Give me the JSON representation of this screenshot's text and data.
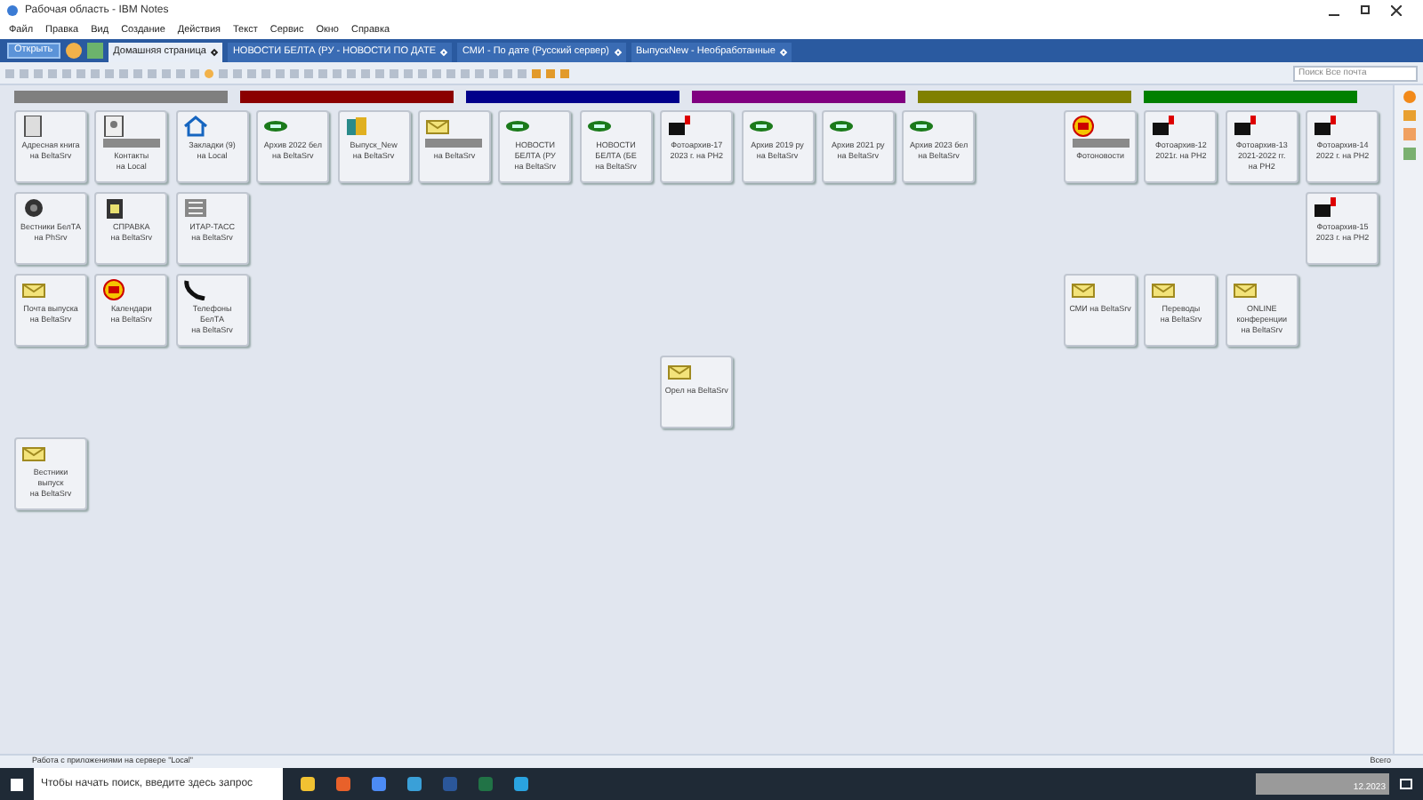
{
  "window": {
    "title": "Рабочая область - IBM Notes"
  },
  "menu": [
    "Файл",
    "Правка",
    "Вид",
    "Создание",
    "Действия",
    "Текст",
    "Сервис",
    "Окно",
    "Справка"
  ],
  "open_button": "Открыть",
  "tabs": [
    {
      "label": "Домашняя страница",
      "selected": true
    },
    {
      "label": "НОВОСТИ БЕЛТА (РУ - НОВОСТИ ПО ДАТЕ",
      "selected": false
    },
    {
      "label": "СМИ - По дате (Русский сервер)",
      "selected": false
    },
    {
      "label": "ВыпускNew - Необработанные",
      "selected": false
    }
  ],
  "search": {
    "placeholder": "Поиск Все почта"
  },
  "bands": [
    {
      "color": "#7f7f7f"
    },
    {
      "color": "#8b0000"
    },
    {
      "color": "#00008b"
    },
    {
      "color": "#800080"
    },
    {
      "color": "#808000"
    },
    {
      "color": "#008000"
    }
  ],
  "tiles": [
    {
      "kind": "book",
      "lines": [
        "Адресная книга",
        "на BeltaSrv"
      ],
      "redacted": false
    },
    {
      "kind": "contacts",
      "lines": [
        "Контакты",
        "на Local"
      ],
      "redacted": true
    },
    {
      "kind": "home",
      "lines": [
        "Закладки (9)",
        "на Local"
      ],
      "redacted": false
    },
    {
      "kind": "db",
      "lines": [
        "Архив 2022 бел",
        "на BeltaSrv"
      ],
      "redacted": false
    },
    {
      "kind": "books",
      "lines": [
        "Выпуск_New",
        "на BeltaSrv"
      ],
      "redacted": false
    },
    {
      "kind": "mail",
      "lines": [
        "на BeltaSrv"
      ],
      "redacted": true
    },
    {
      "kind": "db",
      "lines": [
        "НОВОСТИ",
        "БЕЛТА (РУ",
        "на BeltaSrv"
      ],
      "redacted": false
    },
    {
      "kind": "db",
      "lines": [
        "НОВОСТИ",
        "БЕЛТА (БЕ",
        "на BeltaSrv"
      ],
      "redacted": false
    },
    {
      "kind": "camera",
      "lines": [
        "Фотоархив-17",
        "2023 г. на PH2"
      ],
      "redacted": false
    },
    {
      "kind": "db",
      "lines": [
        "Архив 2019 ру",
        "на BeltaSrv"
      ],
      "redacted": false
    },
    {
      "kind": "db",
      "lines": [
        "Архив 2021 ру",
        "на BeltaSrv"
      ],
      "redacted": false
    },
    {
      "kind": "db",
      "lines": [
        "Архив 2023 бел",
        "на BeltaSrv"
      ],
      "redacted": false
    },
    {
      "kind": "stamp",
      "lines": [
        "Фотоновости"
      ],
      "redacted": true
    },
    {
      "kind": "camera",
      "lines": [
        "Фотоархив-12",
        "2021г. на PH2"
      ],
      "redacted": false
    },
    {
      "kind": "camera",
      "lines": [
        "Фотоархив-13",
        "2021-2022 гг.",
        "на PH2"
      ],
      "redacted": false
    },
    {
      "kind": "camera",
      "lines": [
        "Фотоархив-14",
        "2022 г. на PH2"
      ],
      "redacted": false
    },
    {
      "kind": "gear",
      "lines": [
        "Вестники БелТА",
        "на PhSrv"
      ],
      "redacted": false
    },
    {
      "kind": "doc",
      "lines": [
        "СПРАВКА",
        "на BeltaSrv"
      ],
      "redacted": false
    },
    {
      "kind": "tass",
      "lines": [
        "ИТАР-ТАСС",
        "на BeltaSrv"
      ],
      "redacted": false
    },
    {
      "kind": "camera",
      "lines": [
        "Фотоархив-15",
        "2023 г. на PH2"
      ],
      "redacted": false
    },
    {
      "kind": "mail",
      "lines": [
        "Почта выпуска",
        "на BeltaSrv"
      ],
      "redacted": false
    },
    {
      "kind": "stamp",
      "lines": [
        "Календари",
        "на BeltaSrv"
      ],
      "redacted": false
    },
    {
      "kind": "phone",
      "lines": [
        "Телефоны",
        "БелТА",
        "на BeltaSrv"
      ],
      "redacted": false
    },
    {
      "kind": "mail",
      "lines": [
        "СМИ на BeltaSrv"
      ],
      "redacted": false
    },
    {
      "kind": "mail",
      "lines": [
        "Переводы",
        "на BeltaSrv"
      ],
      "redacted": false
    },
    {
      "kind": "mail",
      "lines": [
        "ONLINE",
        "конференции",
        "на BeltaSrv"
      ],
      "redacted": false
    },
    {
      "kind": "mail",
      "lines": [
        "Орел на BeltaSrv"
      ],
      "redacted": false
    },
    {
      "kind": "mail",
      "lines": [
        "Вестники",
        "выпуск",
        "на BeltaSrv"
      ],
      "redacted": false
    }
  ],
  "status_bar": {
    "text": "Работа с приложениями на сервере \"Local\"",
    "right": "Всего"
  },
  "taskbar": {
    "search_placeholder": "Чтобы начать поиск, введите здесь запрос",
    "date": "12.2023"
  }
}
